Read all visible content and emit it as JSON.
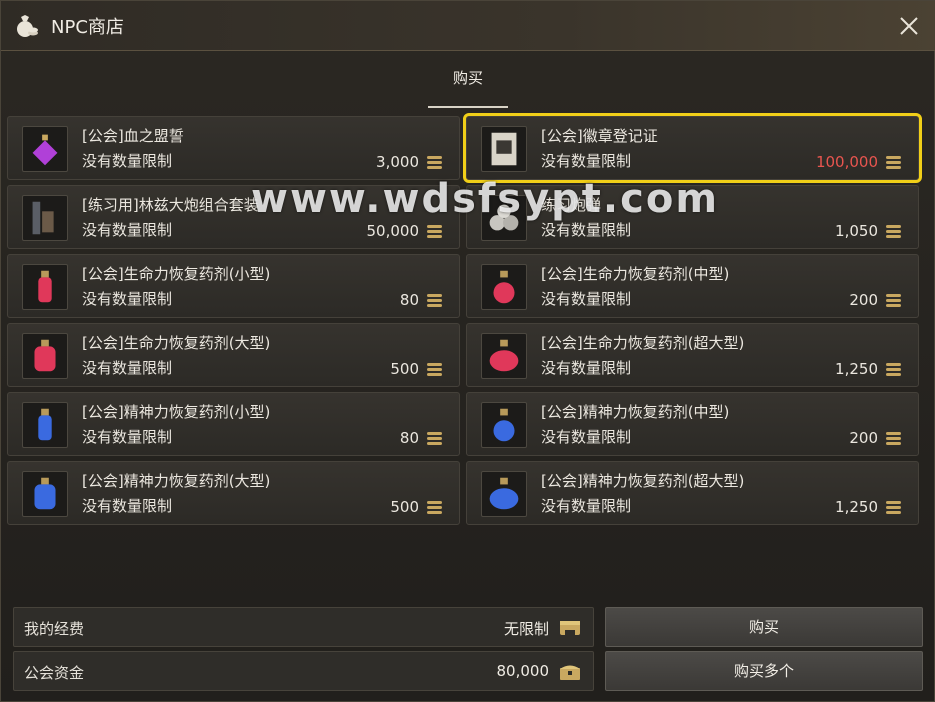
{
  "window": {
    "title": "NPC商店"
  },
  "tabs": [
    {
      "label": "购买"
    }
  ],
  "items": [
    {
      "name": "[公会]血之盟誓",
      "limit": "没有数量限制",
      "price": "3,000",
      "icon": "purple-potion-icon",
      "selected": false,
      "price_color": "#ebe7df"
    },
    {
      "name": "[公会]徽章登记证",
      "limit": "没有数量限制",
      "price": "100,000",
      "icon": "scroll-certificate-icon",
      "selected": true,
      "price_color": "#e8554f"
    },
    {
      "name": "[练习用]林兹大炮组合套装",
      "limit": "没有数量限制",
      "price": "50,000",
      "icon": "cannon-set-icon",
      "selected": false,
      "price_color": "#ebe7df"
    },
    {
      "name": "练习炮弹",
      "limit": "没有数量限制",
      "price": "1,050",
      "icon": "cannonball-icon",
      "selected": false,
      "price_color": "#ebe7df"
    },
    {
      "name": "[公会]生命力恢复药剂(小型)",
      "limit": "没有数量限制",
      "price": "80",
      "icon": "red-potion-small-icon",
      "selected": false,
      "price_color": "#ebe7df"
    },
    {
      "name": "[公会]生命力恢复药剂(中型)",
      "limit": "没有数量限制",
      "price": "200",
      "icon": "red-potion-medium-icon",
      "selected": false,
      "price_color": "#ebe7df"
    },
    {
      "name": "[公会]生命力恢复药剂(大型)",
      "limit": "没有数量限制",
      "price": "500",
      "icon": "red-potion-large-icon",
      "selected": false,
      "price_color": "#ebe7df"
    },
    {
      "name": "[公会]生命力恢复药剂(超大型)",
      "limit": "没有数量限制",
      "price": "1,250",
      "icon": "red-potion-xlarge-icon",
      "selected": false,
      "price_color": "#ebe7df"
    },
    {
      "name": "[公会]精神力恢复药剂(小型)",
      "limit": "没有数量限制",
      "price": "80",
      "icon": "blue-potion-small-icon",
      "selected": false,
      "price_color": "#ebe7df"
    },
    {
      "name": "[公会]精神力恢复药剂(中型)",
      "limit": "没有数量限制",
      "price": "200",
      "icon": "blue-potion-medium-icon",
      "selected": false,
      "price_color": "#ebe7df"
    },
    {
      "name": "[公会]精神力恢复药剂(大型)",
      "limit": "没有数量限制",
      "price": "500",
      "icon": "blue-potion-large-icon",
      "selected": false,
      "price_color": "#ebe7df"
    },
    {
      "name": "[公会]精神力恢复药剂(超大型)",
      "limit": "没有数量限制",
      "price": "1,250",
      "icon": "blue-potion-xlarge-icon",
      "selected": false,
      "price_color": "#ebe7df"
    }
  ],
  "watermark": "www.wdsfsypt.com",
  "footer": {
    "my_funds_label": "我的经费",
    "my_funds_value": "无限制",
    "guild_funds_label": "公会资金",
    "guild_funds_value": "80,000",
    "buy_label": "购买",
    "buy_multiple_label": "购买多个"
  },
  "colors": {
    "selection": "#f1cf18",
    "price_red": "#e8554f",
    "coin": "#c9a860"
  }
}
